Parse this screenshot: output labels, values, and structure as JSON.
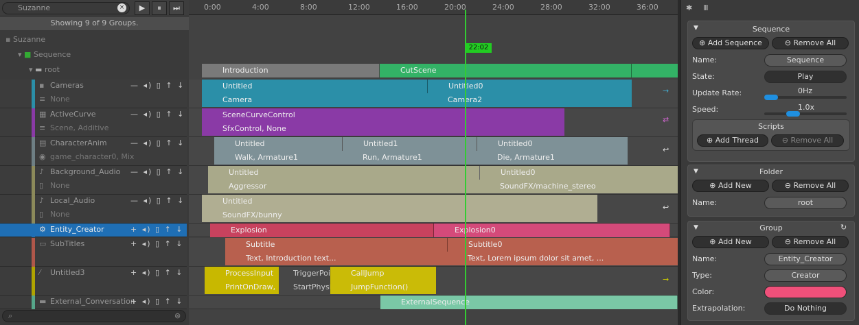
{
  "search": {
    "value": "Suzanne"
  },
  "playback": {
    "play": "▶",
    "pause": "⏸",
    "next": "⏭"
  },
  "status": {
    "showing": "Showing 9 of 9 Groups."
  },
  "tree": {
    "root_object": "Suzanne",
    "sequence": "Sequence",
    "folder": "root"
  },
  "tracks": [
    {
      "name": "Cameras",
      "sub": "None",
      "color": "#2b8fa8"
    },
    {
      "name": "ActiveCurve",
      "sub": "Scene, Additive",
      "color": "#8a3aa6"
    },
    {
      "name": "CharacterAnim",
      "sub": "game_character0, Mix",
      "color": "#6e7f84"
    },
    {
      "name": "Background_Audio",
      "sub": "None",
      "color": "#8c8a5a"
    },
    {
      "name": "Local_Audio",
      "sub": "None",
      "color": "#8c8a5a"
    },
    {
      "name": "Entity_Creator",
      "sub": "",
      "color": "#1f6fb5"
    },
    {
      "name": "SubTitles",
      "sub": "",
      "color": "#b0574a"
    },
    {
      "name": "Untitled3",
      "sub": "",
      "color": "#b0a400"
    },
    {
      "name": "External_Conversation",
      "sub": "",
      "color": "#56a68a"
    }
  ],
  "ruler": {
    "ticks": [
      "0:00",
      "4:00",
      "8:00",
      "12:00",
      "16:00",
      "20:00",
      "24:00",
      "28:00",
      "32:00",
      "36:00"
    ]
  },
  "playhead": {
    "label": "22:02"
  },
  "clips": {
    "intro": "Introduction",
    "cutscene": "CutScene",
    "cam1_top": "Untitled",
    "cam1_bot": "Camera",
    "cam2_top": "Untitled0",
    "cam2_bot": "Camera2",
    "curve_top": "SceneCurveControl",
    "curve_bot": "SfxControl, None",
    "anim1_top": "Untitled",
    "anim1_bot": "Walk, Armature1",
    "anim2_top": "Untitled1",
    "anim2_bot": "Run, Armature1",
    "anim3_top": "Untitled0",
    "anim3_bot": "Die, Armature1",
    "bg1_top": "Untitled",
    "bg1_bot": "Aggressor",
    "bg2_top": "Untitled0",
    "bg2_bot": "SoundFX/machine_stereo",
    "local_top": "Untitled",
    "local_bot": "SoundFX/bunny",
    "explosion": "Explosion",
    "explosion0": "Explosion0",
    "sub1_top": "Subtitle",
    "sub1_bot": "Text, Introduction text...",
    "sub2_top": "Subtitle0",
    "sub2_bot": "Text, Lorem ipsum dolor sit amet, ...",
    "pi_top": "ProcessInput",
    "pi_bot": "PrintOnDraw,",
    "tp_top": "TriggerPoi",
    "tp_bot": "StartPhysi",
    "cj_top": "CallJump",
    "cj_bot": "JumpFunction()",
    "external": "ExternalSequence"
  },
  "inspector": {
    "sequence": {
      "title": "Sequence",
      "add": "Add Sequence",
      "remove": "Remove All",
      "name_label": "Name:",
      "name_value": "Sequence",
      "state_label": "State:",
      "state_value": "Play",
      "rate_label": "Update Rate:",
      "rate_value": "0Hz",
      "speed_label": "Speed:",
      "speed_value": "1.0x",
      "scripts_title": "Scripts",
      "add_thread": "Add Thread",
      "remove_all": "Remove All"
    },
    "folder": {
      "title": "Folder",
      "add": "Add New",
      "remove": "Remove All",
      "name_label": "Name:",
      "name_value": "root"
    },
    "group": {
      "title": "Group",
      "add": "Add New",
      "remove": "Remove All",
      "name_label": "Name:",
      "name_value": "Entity_Creator",
      "type_label": "Type:",
      "type_value": "Creator",
      "color_label": "Color:",
      "color_value": "#f0507a",
      "extrap_label": "Extrapolation:",
      "extrap_value": "Do Nothing"
    }
  }
}
